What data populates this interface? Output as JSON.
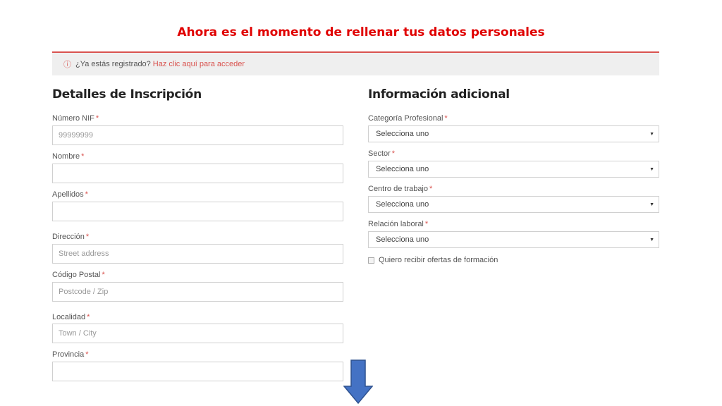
{
  "page": {
    "title": "Ahora es el momento de rellenar tus datos personales"
  },
  "notice": {
    "icon": "info-circle-icon",
    "text": "¿Ya estás registrado?",
    "link_text": "Haz clic aquí para acceder"
  },
  "registration": {
    "title": "Detalles de Inscripción",
    "required_mark": "*",
    "fields": {
      "nif": {
        "label": "Número NIF",
        "value": "",
        "placeholder": "99999999"
      },
      "nombre": {
        "label": "Nombre",
        "value": "",
        "placeholder": ""
      },
      "apellidos": {
        "label": "Apellidos",
        "value": "",
        "placeholder": ""
      },
      "direccion": {
        "label": "Dirección",
        "value": "",
        "placeholder": "Street address"
      },
      "codigo_postal": {
        "label": "Código Postal",
        "value": "",
        "placeholder": "Postcode / Zip"
      },
      "localidad": {
        "label": "Localidad",
        "value": "",
        "placeholder": "Town / City"
      },
      "provincia": {
        "label": "Provincia",
        "value": "",
        "placeholder": ""
      }
    }
  },
  "additional": {
    "title": "Información adicional",
    "required_mark": "*",
    "selects": {
      "categoria": {
        "label": "Categoría Profesional",
        "selected": "Selecciona uno"
      },
      "sector": {
        "label": "Sector",
        "selected": "Selecciona uno"
      },
      "centro": {
        "label": "Centro de trabajo",
        "selected": "Selecciona uno"
      },
      "relacion": {
        "label": "Relación laboral",
        "selected": "Selecciona uno"
      }
    },
    "offers_checkbox": {
      "label": "Quiero recibir ofertas de formación",
      "checked": false
    }
  },
  "colors": {
    "title_red": "#e00000",
    "accent": "#d9534f",
    "arrow_blue": "#4472c4"
  },
  "icons": {
    "select_caret": "caret-down-icon",
    "scroll_hint": "down-arrow-icon"
  }
}
